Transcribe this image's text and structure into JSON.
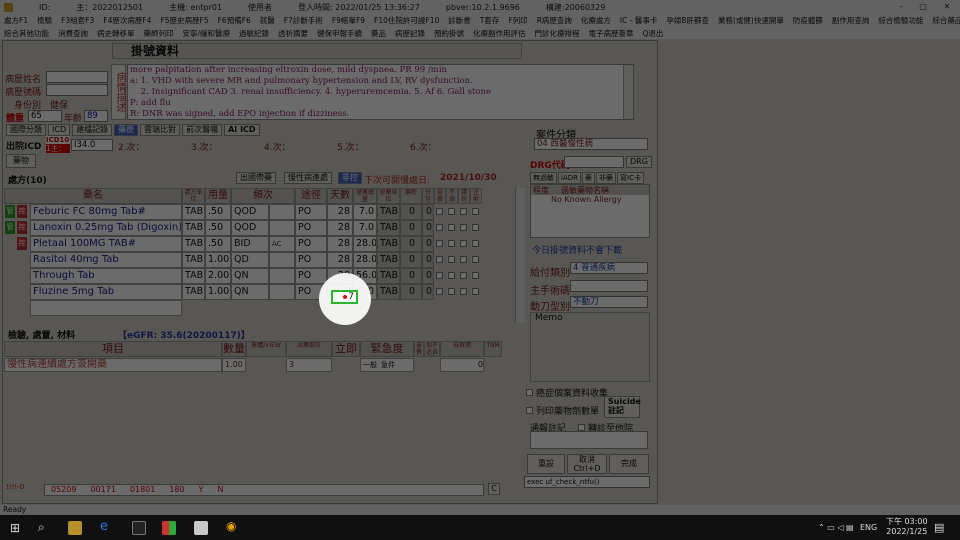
{
  "titlebar": {
    "id_label": "ID:",
    "session": "主：2022012501",
    "host": "主機: entpr01",
    "user": "使用者",
    "login_time": "登入時間: 2022/01/25 13:36:27",
    "server": "pbver:10.2.1.9696",
    "build": "構建:20060329"
  },
  "menu_row1": [
    "處方F1",
    "檢驗",
    "F3組套F3",
    "F4歷次病歷F4",
    "F5歷史病歷F5",
    "F6預備F6",
    "就醫",
    "F7診斷手術",
    "F9帳單F9",
    "F10住院許可證F10",
    "診斷書",
    "T套存",
    "F列印",
    "R病歷查詢",
    "化療處方",
    "IC - 醫事卡",
    "孕婦B肝篩查",
    "業務(或健)快速開單",
    "防疫體篩",
    "副作用查詢",
    "綜合檢驗功能",
    "綜合藥品功能"
  ],
  "menu_row2": [
    "綜合其他功能",
    "消費查詢",
    "病史轉移單",
    "藥師列印",
    "安寧/緩和醫療",
    "過敏紀錄",
    "透析摘要",
    "健保申報手續",
    "藥品",
    "病歷記錄",
    "預約掛號",
    "化療副作用評估",
    "門診化療排程",
    "電子病歷簽章",
    "Q退出"
  ],
  "header": {
    "title": "掛號資料"
  },
  "patient": {
    "name_label": "病歷姓名",
    "record_label": "病歷號碼",
    "id_label": "身份別",
    "id_value": "健保",
    "weight_label": "體重",
    "weight_value": "65",
    "age_label": "年齡",
    "age_value": "89"
  },
  "description": {
    "vertical_label": "病情描述",
    "lines": [
      "more palpitation after increasing eltroxin dose, mild dyspnea. PR 99 /min",
      "a: 1. VHD with severe MR and pulmonary hypertension and LV, RV dysfunction.",
      "    2. Insignificant CAD 3. renal insufficiency. 4. hyperuremcemia. 5. Af 6. Gall stone",
      "P: add flu",
      "R: DNR was signed, add EPO injection if dizziness."
    ]
  },
  "tabs_top": [
    "國際分類",
    "ICD",
    "建檔記錄",
    "藥歷",
    "雲端比對",
    "前次醫囑",
    "AI ICD"
  ],
  "diag": {
    "label": "出院ICD",
    "icd_badge": "ICD10",
    "main_badge": "1主：",
    "code": "I34.0",
    "times": [
      "2.次：",
      "3.次：",
      "4.次：",
      "5.次：",
      "6.次："
    ]
  },
  "drug_tab": "藥物",
  "rx": {
    "title": "處方(10)",
    "buttons": [
      "出國帶藥",
      "慢性病連處"
    ],
    "button_active": "非控",
    "next_label": "下次可開慢處日:",
    "next_date": "2021/10/30",
    "columns": [
      "藥名",
      "處方單位",
      "用量",
      "頻次",
      "途徑",
      "天數",
      "發藥總量",
      "發藥單位",
      "磨粉",
      "分包",
      "自費",
      "不須自費",
      "請勿",
      "注射",
      "暫不"
    ],
    "rows": [
      {
        "flag": "管",
        "tag": "控",
        "name": "Feburic FC 80mg Tab#",
        "unit": "TAB",
        "dose": ".50",
        "freq": "QOD",
        "note": "",
        "route": "PO",
        "days": "28",
        "qty": "7.0",
        "qunit": "TAB",
        "grind": "0",
        "pack": "0"
      },
      {
        "flag": "管",
        "tag": "控",
        "name": "Lanoxin 0.25mg Tab (Digoxin)",
        "unit": "TAB",
        "dose": ".50",
        "freq": "QOD",
        "note": "",
        "route": "PO",
        "days": "28",
        "qty": "7.0",
        "qunit": "TAB",
        "grind": "0",
        "pack": "0"
      },
      {
        "flag": "",
        "tag": "控",
        "name": "Pletaal 100MG TAB#",
        "unit": "TAB",
        "dose": ".50",
        "freq": "BID",
        "note": "AC",
        "route": "PO",
        "days": "28",
        "qty": "28.0",
        "qunit": "TAB",
        "grind": "0",
        "pack": "0"
      },
      {
        "flag": "",
        "tag": "",
        "name": "Rasitol 40mg Tab",
        "unit": "TAB",
        "dose": "1.00",
        "freq": "QD",
        "note": "",
        "route": "PO",
        "days": "28",
        "qty": "28.0",
        "qunit": "TAB",
        "grind": "0",
        "pack": "0"
      },
      {
        "flag": "",
        "tag": "",
        "name": "Through Tab",
        "unit": "TAB",
        "dose": "2.00",
        "freq": "QN",
        "note": "",
        "route": "PO",
        "days": "28",
        "qty": "56.0",
        "qunit": "TAB",
        "grind": "0",
        "pack": "0"
      },
      {
        "flag": "",
        "tag": "",
        "name": "Fluzine 5mg Tab",
        "unit": "TAB",
        "dose": "1.00",
        "freq": "QN",
        "note": "",
        "route": "PO",
        "days": "7",
        "qty": "7.0",
        "qunit": "TAB",
        "grind": "0",
        "pack": "0"
      }
    ]
  },
  "exam": {
    "title": "檢驗, 處置, 材料",
    "egfr": "【eGFR: 35.6(20200117)】",
    "columns": [
      "項目",
      "數量",
      "檢體/VIEW",
      "治療部位",
      "立即",
      "緊急度",
      "自費",
      "如不必自費",
      "自費價",
      "TNM"
    ],
    "row": {
      "item": "慢性病連續處方簽開藥",
      "qty": "1.00",
      "site": "3",
      "urgent1": "一般",
      "urgent2": "急件",
      "price": "0"
    }
  },
  "side": {
    "case_label": "案件分類",
    "case_value": "04  西醫慢性病",
    "drg_label": "DRG代碼",
    "drg_btn": "DRG",
    "tabs": [
      "無過敏",
      "iADR",
      "藥",
      "非藥",
      "寫IC卡"
    ],
    "allergy_cols": [
      "程度",
      "過敏藥物名稱"
    ],
    "allergy_value": "No Known Allergy",
    "today_note": "今日掛號資料不會下載",
    "pay_label": "給付類別",
    "pay_value": "4   普通疾病",
    "surgeon_label": "主手術碼",
    "op_label": "動刀型別",
    "op_value": "不動刀",
    "memo_label": "Memo",
    "cancer_chk": "癌症個案資料收集",
    "print_chk": "列印藥物劑數單",
    "suicide_btn": "Suicide註記",
    "report_label": "通報註記",
    "transfer_chk": "轉診至他院",
    "action_buttons": [
      "重設",
      "取消 Ctrl+D",
      "完成"
    ],
    "exec_text": "exec uf_check_ntfu()"
  },
  "footer": {
    "code_label": "!!!!-0",
    "codes": [
      "05209",
      "00171",
      "01801",
      "180",
      "Y",
      "N"
    ],
    "c_btn": "C"
  },
  "status": {
    "text": "Ready"
  },
  "taskbar": {
    "time": "下午 03:00",
    "date": "2022/1/25",
    "lang": "ENG"
  }
}
